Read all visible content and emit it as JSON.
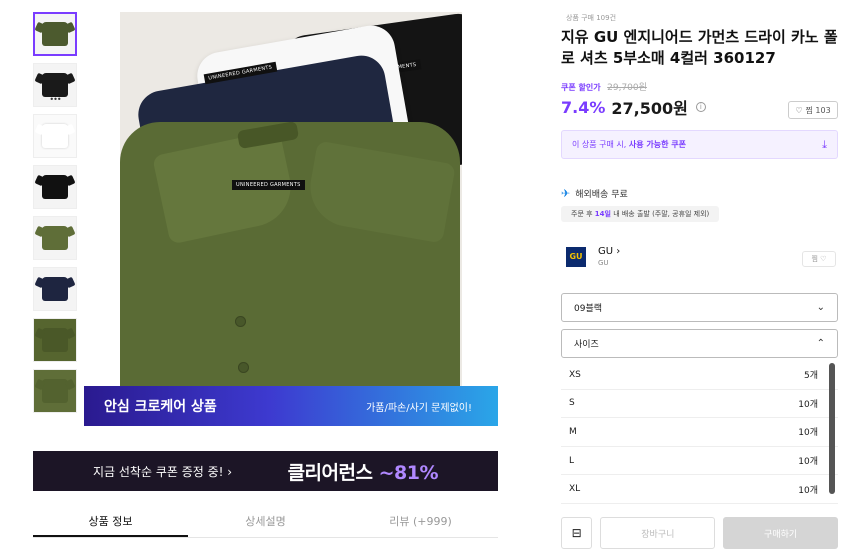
{
  "thumbnails": [
    {
      "color": "#4c5a2e",
      "active": true
    },
    {
      "color": "#1a1a1a",
      "more": "•••"
    },
    {
      "color": "#ffffff"
    },
    {
      "color": "#111111"
    },
    {
      "color": "#5f6e38"
    },
    {
      "color": "#1e2540"
    },
    {
      "color": "#56652f"
    },
    {
      "color": "#5f6e38"
    }
  ],
  "image": {
    "tag_text": "UNINEERED GARMENTS",
    "tag_text_short": "GARMENTS"
  },
  "care_banner": {
    "title": "안심 크로케어 상품",
    "subtitle": "가품/파손/사기 문제없이!"
  },
  "coupon_banner": {
    "left": "지금 선착순 쿠폰 증정 중! ›",
    "brand": "클리어런스 ",
    "pct": "~81%"
  },
  "tabs": [
    "상품 정보",
    "상세설명",
    "리뷰 (+999)"
  ],
  "product": {
    "sold": "상품 구매 109건",
    "title": "지유 GU 엔지니어드 가먼츠 드라이 카노 폴로 셔츠 5부소매 4컬러 360127",
    "discount_label": "쿠폰 할인가",
    "original_price": "29,700원",
    "discount_rate": "7.4%",
    "price": "27,500원",
    "info_icon": "ⓘ",
    "like_label": "찜 103"
  },
  "coupon_box": {
    "text_a": "이 상품 구매 시, ",
    "text_b": "사용 가능한 쿠폰",
    "icon": "download-icon"
  },
  "shipping": {
    "label": "해외배송 무료",
    "note_a": "주문 후 ",
    "note_hl": "14일",
    "note_b": " 내 배송 출발 (주말, 공휴일 제외)"
  },
  "brand": {
    "logo": "GU",
    "name": "GU ›",
    "sub": "GU",
    "like": "찜 ♡"
  },
  "options": {
    "color_selected": "09블랙",
    "size_label": "사이즈"
  },
  "sizes": [
    {
      "name": "XS",
      "stock": "5개"
    },
    {
      "name": "S",
      "stock": "10개"
    },
    {
      "name": "M",
      "stock": "10개"
    },
    {
      "name": "L",
      "stock": "10개"
    },
    {
      "name": "XL",
      "stock": "10개"
    }
  ],
  "actions": {
    "cart": "장바구니",
    "buy": "구매하기"
  },
  "colors": {
    "accent": "#7a3cff"
  }
}
